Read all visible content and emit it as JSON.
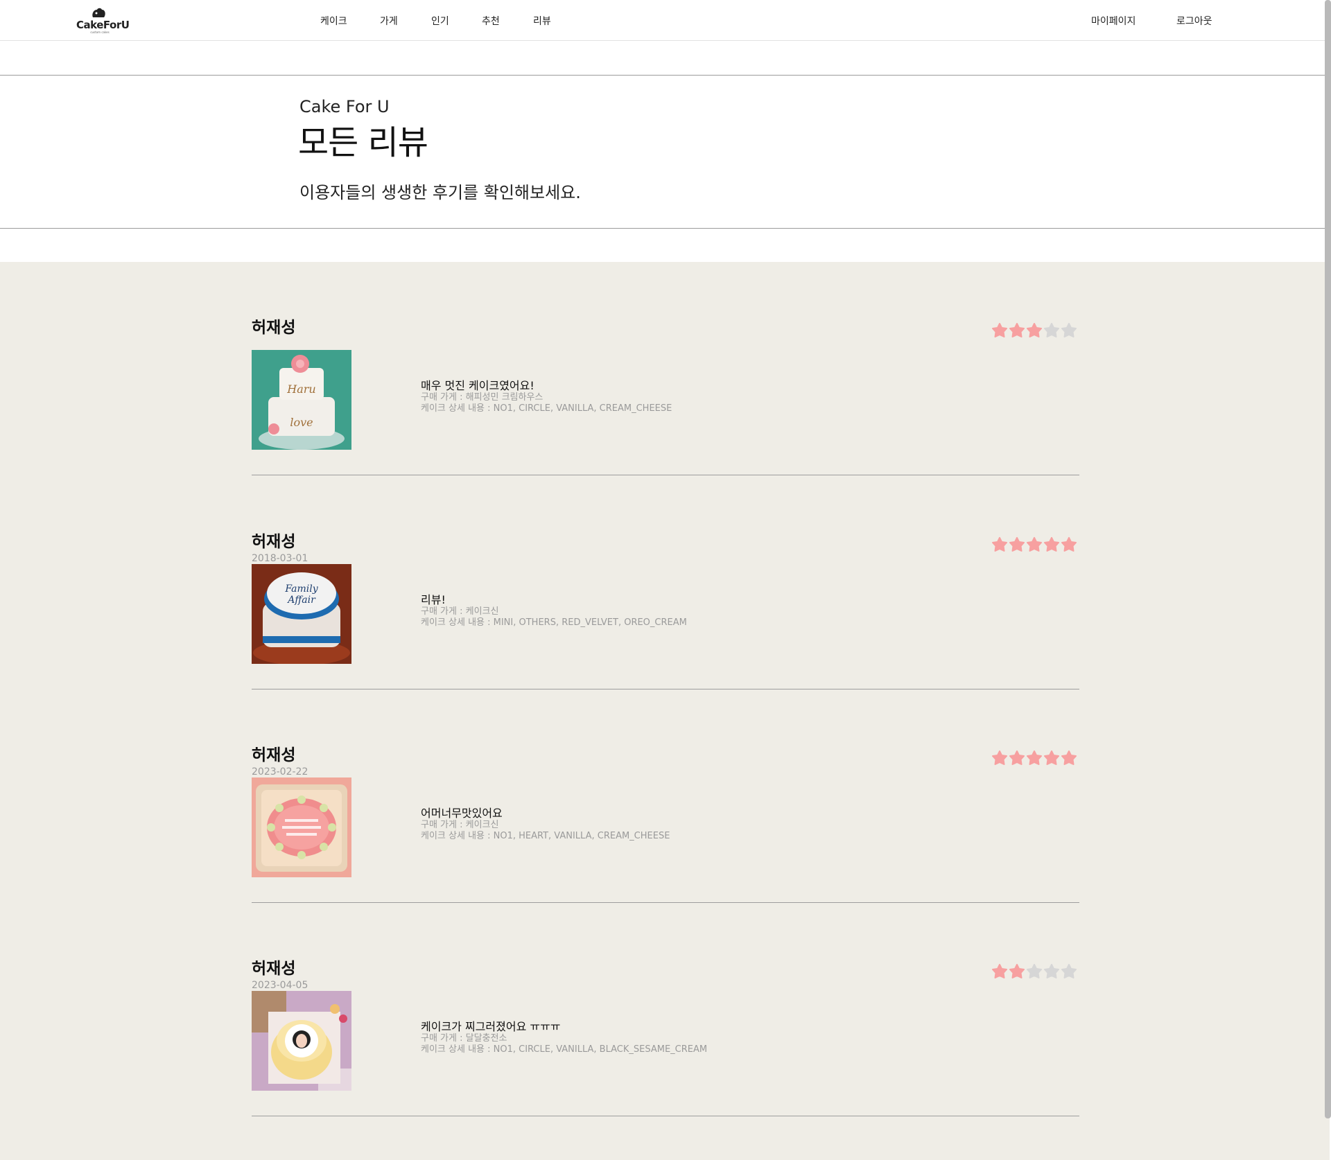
{
  "brand": {
    "name": "CakeForU",
    "tagline": "custom cakes"
  },
  "nav": {
    "items": [
      "케이크",
      "가게",
      "인기",
      "추천",
      "리뷰"
    ],
    "right": [
      "마이페이지",
      "로그아웃"
    ]
  },
  "hero": {
    "subtitle": "Cake For U",
    "title": "모든 리뷰",
    "description": "이용자들의 생생한 후기를 확인해보세요."
  },
  "colors": {
    "star_on": "#f7a0a0",
    "star_off": "#d6d6d6",
    "bg": "#efede6"
  },
  "reviews": [
    {
      "author": "허재성",
      "date": "",
      "rating": 3,
      "title": "매우 멋진 케이크였어요!",
      "store": "구매 가게 : 해피성민 크림하우스",
      "detail": "케이크 상세 내용 : NO1, CIRCLE, VANILLA, CREAM_CHEESE",
      "image": "tiered-white-cake-with-pink-rose"
    },
    {
      "author": "허재성",
      "date": "2018-03-01",
      "rating": 5,
      "title": "리뷰!",
      "store": "구매 가게 : 케이크신",
      "detail": "케이크 상세 내용 : MINI, OTHERS, RED_VELVET, OREO_CREAM",
      "image": "blue-white-two-tier-cake"
    },
    {
      "author": "허재성",
      "date": "2023-02-22",
      "rating": 5,
      "title": "어머너무맛있어요",
      "store": "구매 가게 : 케이크신",
      "detail": "케이크 상세 내용 : NO1, HEART, VANILLA, CREAM_CHEESE",
      "image": "pink-lunchbox-cake"
    },
    {
      "author": "허재성",
      "date": "2023-04-05",
      "rating": 2,
      "title": "케이크가 찌그러졌어요 ㅠㅠㅠ",
      "store": "구매 가게 : 달달충전소",
      "detail": "케이크 상세 내용 : NO1, CIRCLE, VANILLA, BLACK_SESAME_CREAM",
      "image": "photo-print-cake"
    }
  ]
}
